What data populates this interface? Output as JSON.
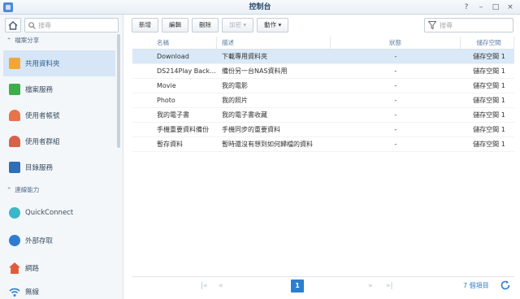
{
  "window": {
    "title": "控制台",
    "controls": [
      "?",
      "–",
      "□",
      "×"
    ]
  },
  "sidebar": {
    "search_placeholder": "搜尋",
    "sections": [
      {
        "label": "檔案分享"
      },
      {
        "label": "連線能力"
      }
    ],
    "items": [
      {
        "label": "共用資料夾",
        "icon": "shared-folder-icon",
        "active": true
      },
      {
        "label": "檔案服務",
        "icon": "file-services-icon"
      },
      {
        "label": "使用者帳號",
        "icon": "user-icon"
      },
      {
        "label": "使用者群組",
        "icon": "group-icon"
      },
      {
        "label": "目錄服務",
        "icon": "directory-icon"
      },
      {
        "label": "QuickConnect",
        "icon": "quickconnect-icon"
      },
      {
        "label": "外部存取",
        "icon": "globe-icon"
      },
      {
        "label": "網路",
        "icon": "network-icon"
      },
      {
        "label": "無線",
        "icon": "wifi-icon"
      }
    ]
  },
  "toolbar": {
    "buttons": [
      {
        "label": "新增"
      },
      {
        "label": "編輯"
      },
      {
        "label": "刪除"
      },
      {
        "label": "加密 ▾",
        "disabled": true
      },
      {
        "label": "動作 ▾"
      }
    ],
    "filter_placeholder": "搜尋"
  },
  "table": {
    "columns": [
      "名稱",
      "描述",
      "狀態",
      "儲存空間"
    ],
    "rows": [
      [
        "Download",
        "下載專用資料夾",
        "-",
        "儲存空間 1"
      ],
      [
        "DS214Play Back...",
        "備份另一台NAS資料用",
        "-",
        "儲存空間 1"
      ],
      [
        "Movie",
        "我的電影",
        "-",
        "儲存空間 1"
      ],
      [
        "Photo",
        "我的照片",
        "-",
        "儲存空間 1"
      ],
      [
        "我的電子書",
        "我的電子書收藏",
        "-",
        "儲存空間 1"
      ],
      [
        "手機重要資料備份",
        "手機同步的重要資料",
        "-",
        "儲存空間 1"
      ],
      [
        "暫存資料",
        "暫時還沒有想到如何歸檔的資料",
        "-",
        "儲存空間 1"
      ]
    ],
    "selected_row": 0
  },
  "pager": {
    "first": "|«",
    "prev": "«",
    "page": "1",
    "next": "»",
    "last": "»|",
    "count": "7 個項目"
  },
  "colors": {
    "accent": "#2b7fd1",
    "selected": "#d9e9f7"
  }
}
